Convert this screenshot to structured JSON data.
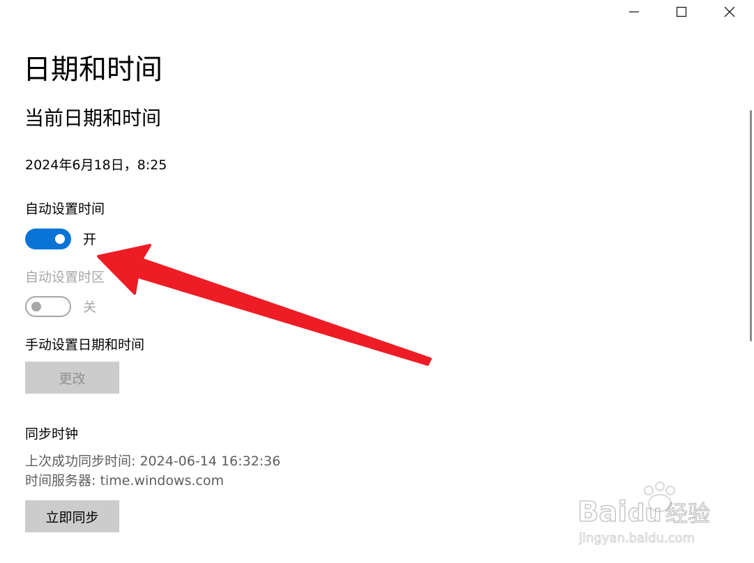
{
  "window": {
    "controls": {
      "minimize_icon": "minimize-icon",
      "maximize_icon": "maximize-icon",
      "close_icon": "close-icon"
    }
  },
  "page": {
    "title": "日期和时间",
    "section_title": "当前日期和时间",
    "current_datetime": "2024年6月18日，8:25"
  },
  "auto_time": {
    "label": "自动设置时间",
    "state": "开",
    "on": true
  },
  "auto_timezone": {
    "label": "自动设置时区",
    "state": "关",
    "on": false,
    "enabled": false
  },
  "manual": {
    "label": "手动设置日期和时间",
    "change_button": "更改",
    "change_enabled": false
  },
  "sync": {
    "title": "同步时钟",
    "last_sync": "上次成功同步时间: 2024-06-14 16:32:36",
    "server": "时间服务器: time.windows.com",
    "sync_button": "立即同步"
  },
  "annotation": {
    "arrow_color": "#ee1c25"
  },
  "colors": {
    "accent": "#0a74d6",
    "disabled_text": "#a7a7a7",
    "button_bg": "#cccccc"
  },
  "watermark": {
    "brand": "Baidu",
    "suffix": "经验",
    "url": "jingyan.baidu.com"
  }
}
